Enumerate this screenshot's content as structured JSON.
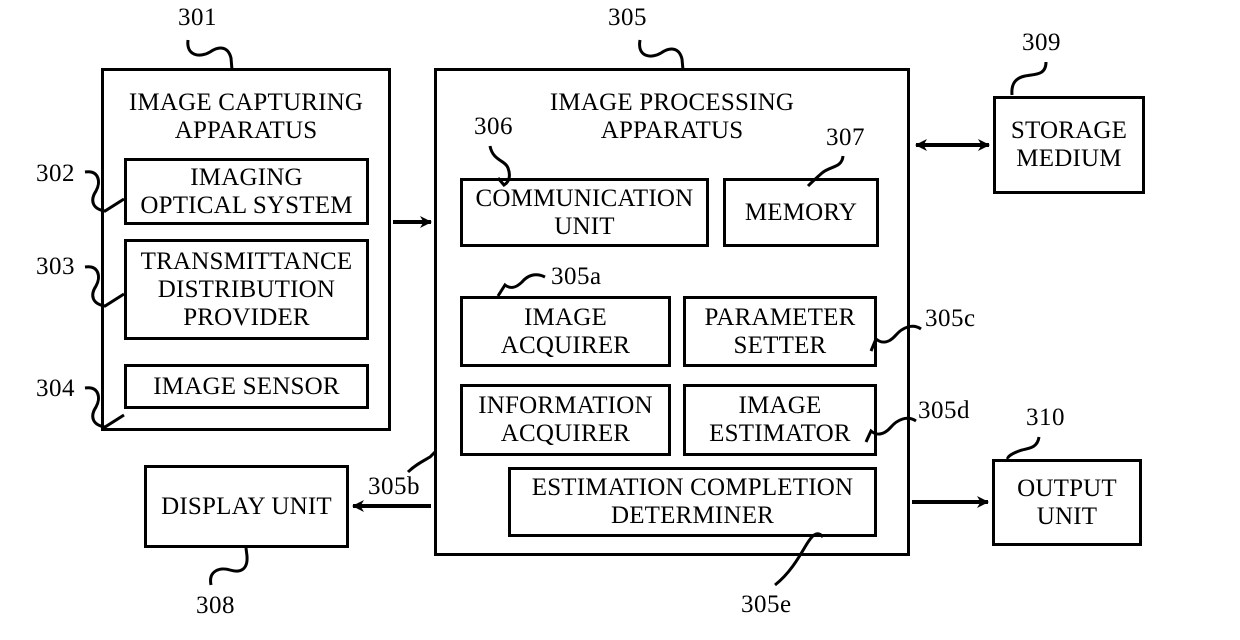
{
  "figure": {
    "type": "patent-block-diagram",
    "background_color": "#ffffff",
    "line_color": "#000000"
  },
  "blocks": {
    "image_capturing_apparatus": "IMAGE CAPTURING\nAPPARATUS",
    "imaging_optical_system": "IMAGING\nOPTICAL SYSTEM",
    "transmittance_distribution_provider": "TRANSMITTANCE\nDISTRIBUTION\nPROVIDER",
    "image_sensor": "IMAGE SENSOR",
    "image_processing_apparatus": "IMAGE PROCESSING\nAPPARATUS",
    "communication_unit": "COMMUNICATION\nUNIT",
    "memory": "MEMORY",
    "image_acquirer": "IMAGE\nACQUIRER",
    "parameter_setter": "PARAMETER\nSETTER",
    "information_acquirer": "INFORMATION\nACQUIRER",
    "image_estimator": "IMAGE\nESTIMATOR",
    "estimation_completion_determiner": "ESTIMATION COMPLETION\nDETERMINER",
    "storage_medium": "STORAGE\nMEDIUM",
    "display_unit": "DISPLAY UNIT",
    "output_unit": "OUTPUT\nUNIT"
  },
  "reference_numerals": {
    "n301": "301",
    "n302": "302",
    "n303": "303",
    "n304": "304",
    "n305": "305",
    "n305a": "305a",
    "n305b": "305b",
    "n305c": "305c",
    "n305d": "305d",
    "n305e": "305e",
    "n306": "306",
    "n307": "307",
    "n308": "308",
    "n309": "309",
    "n310": "310"
  },
  "connections": [
    {
      "name": "capturing-to-processing",
      "from": "image_capturing_apparatus",
      "to": "image_processing_apparatus",
      "style": "arrow-right"
    },
    {
      "name": "processing-to-storage",
      "from": "image_processing_apparatus",
      "to": "storage_medium",
      "style": "arrow-both"
    },
    {
      "name": "processing-to-display",
      "from": "image_processing_apparatus",
      "to": "display_unit",
      "style": "arrow-left"
    },
    {
      "name": "processing-to-output",
      "from": "image_processing_apparatus",
      "to": "output_unit",
      "style": "arrow-right"
    }
  ]
}
